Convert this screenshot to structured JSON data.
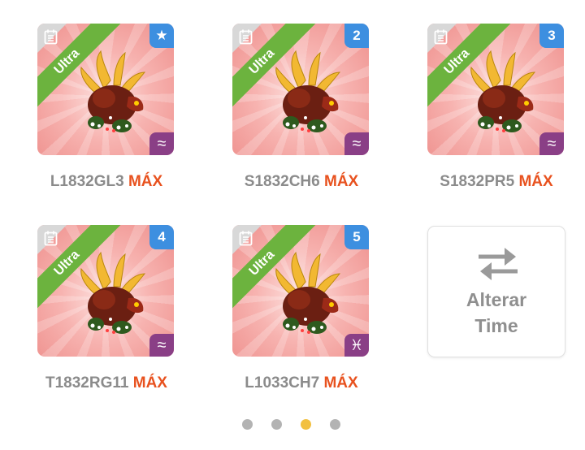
{
  "team_members": [
    {
      "id": "L1832GL3",
      "level": "MÁX",
      "rarity": "Ultra",
      "slot_badge": "★",
      "element_symbol": "≈"
    },
    {
      "id": "S1832CH6",
      "level": "MÁX",
      "rarity": "Ultra",
      "slot_badge": "2",
      "element_symbol": "≈"
    },
    {
      "id": "S1832PR5",
      "level": "MÁX",
      "rarity": "Ultra",
      "slot_badge": "3",
      "element_symbol": "≈"
    },
    {
      "id": "T1832RG11",
      "level": "MÁX",
      "rarity": "Ultra",
      "slot_badge": "4",
      "element_symbol": "≈"
    },
    {
      "id": "L1033CH7",
      "level": "MÁX",
      "rarity": "Ultra",
      "slot_badge": "5",
      "element_symbol": "♓"
    }
  ],
  "change_team": {
    "line1": "Alterar",
    "line2": "Time"
  },
  "pager": {
    "count": 4,
    "active_index": 2
  },
  "colors": {
    "rarity_green": "#6cb33e",
    "badge_blue": "#3d8fe0",
    "element_purple": "#8a3f86",
    "max_orange": "#e8521f",
    "dot_inactive": "#b3b3b3",
    "dot_active": "#f2c040"
  },
  "icons": {
    "note": "notes-icon",
    "favorite": "star-icon",
    "swap": "swap-arrows-icon",
    "element_water": "water-element-icon",
    "element_pisces": "pisces-element-icon"
  }
}
